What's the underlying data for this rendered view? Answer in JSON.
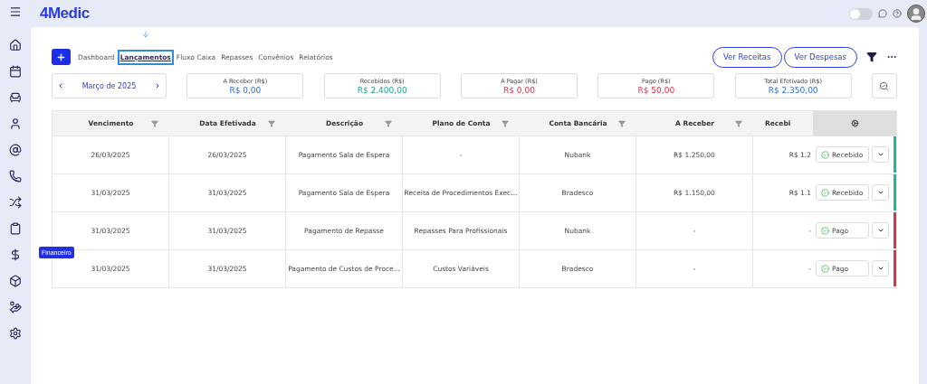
{
  "logo": "4Medic",
  "topbar": {
    "theme_toggle": {
      "on": false
    }
  },
  "sidebar": {
    "tooltip": "Financeiro"
  },
  "tabs": [
    {
      "label": "Dashboard",
      "selected": false
    },
    {
      "label": "Lançamentos",
      "selected": true
    },
    {
      "label": "Fluxo Caixa",
      "selected": false
    },
    {
      "label": "Repasses",
      "selected": false
    },
    {
      "label": "Convênios",
      "selected": false
    },
    {
      "label": "Relatórios",
      "selected": false
    }
  ],
  "buttons": [
    "Ver Receitas",
    "Ver Despesas"
  ],
  "period": "Março de 2025",
  "summary": [
    {
      "label": "A Receber (R$)",
      "value": "R$ 0,00",
      "kind": "neutral"
    },
    {
      "label": "Recebidos (R$)",
      "value": "R$ 2.400,00",
      "kind": "income"
    },
    {
      "label": "A Pagar (R$)",
      "value": "R$ 0,00",
      "kind": "expense"
    },
    {
      "label": "Pago (R$)",
      "value": "R$ 50,00",
      "kind": "expense"
    },
    {
      "label": "Total Efetivado (R$)",
      "value": "R$ 2.350,00",
      "kind": "neutral"
    }
  ],
  "table": {
    "columns": [
      "Vencimento",
      "Data Efetivada",
      "Descrição",
      "Plano de Conta",
      "Conta Bancária",
      "A Receber",
      "Recebi"
    ],
    "rows": [
      {
        "cells": [
          "26/03/2025",
          "26/03/2025",
          "Pagamento Sala de Espera",
          "-",
          "Nubank",
          "R$ 1.250,00",
          "R$ 1.2"
        ],
        "status": "Recebido",
        "color": "#1fb5a0"
      },
      {
        "cells": [
          "31/03/2025",
          "31/03/2025",
          "Pagamento Sala de Espera",
          "Receita de Procedimentos Exec...",
          "Bradesco",
          "R$ 1.150,00",
          "R$ 1.1"
        ],
        "status": "Recebido",
        "color": "#1fb5a0"
      },
      {
        "cells": [
          "31/03/2025",
          "31/03/2025",
          "Pagamento de Repasse",
          "Repasses Para Profissionais",
          "Nubank",
          "-",
          "-"
        ],
        "status": "Pago",
        "color": "#d0384d"
      },
      {
        "cells": [
          "31/03/2025",
          "31/03/2025",
          "Pagamento de Custos de Proce...",
          "Custos Variáveis",
          "Bradesco",
          "-",
          "-"
        ],
        "status": "Pago",
        "color": "#d0384d"
      }
    ]
  }
}
